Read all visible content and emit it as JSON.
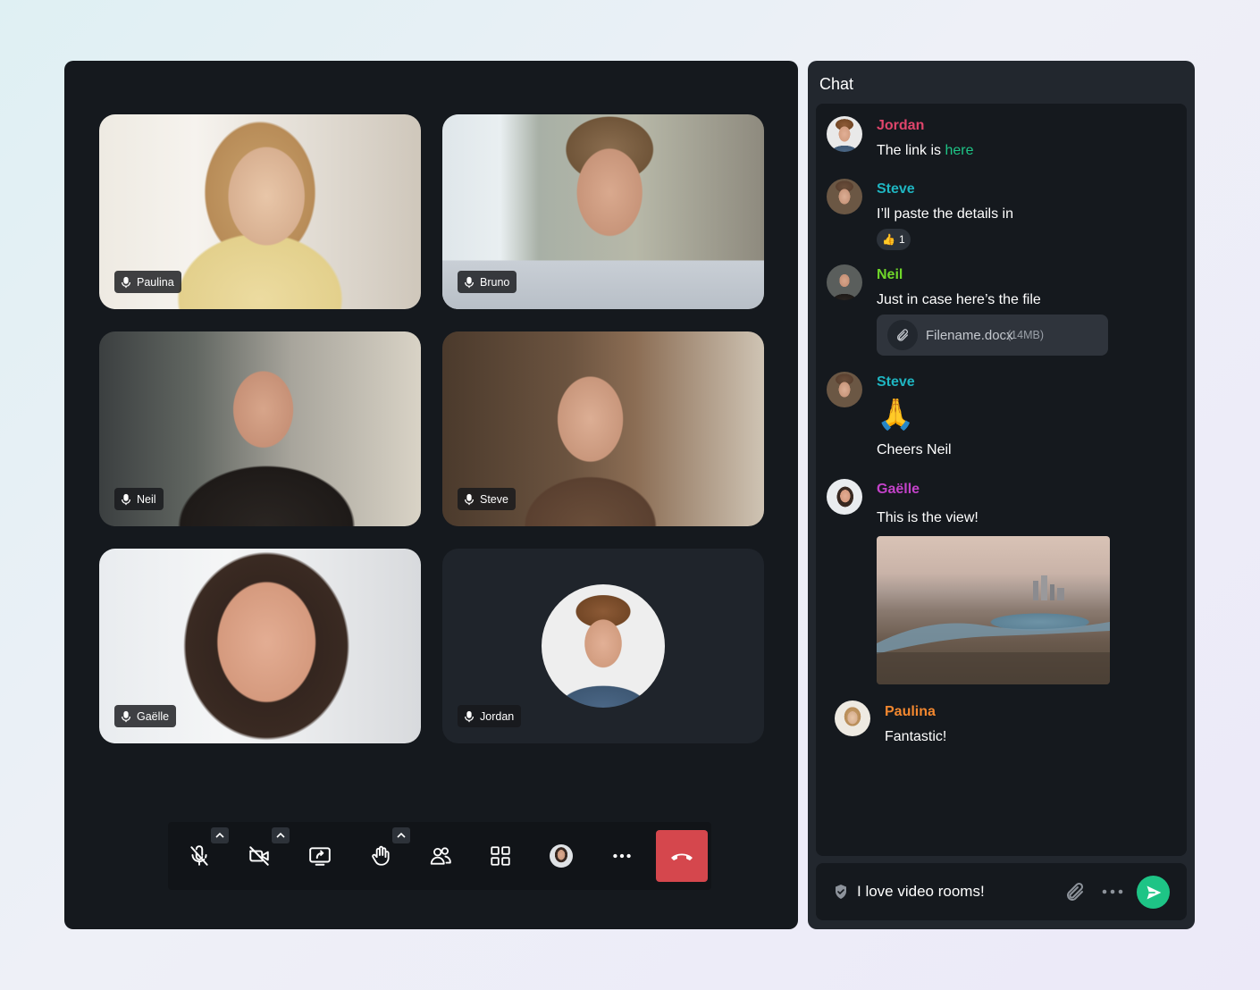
{
  "call": {
    "participants": [
      {
        "name": "Paulina"
      },
      {
        "name": "Bruno"
      },
      {
        "name": "Neil"
      },
      {
        "name": "Steve"
      },
      {
        "name": "Gaëlle"
      },
      {
        "name": "Jordan"
      }
    ],
    "toolbar": {
      "buttons": [
        "mic-off-icon",
        "video-off-icon",
        "share-screen-icon",
        "raise-hand-icon",
        "people-icon",
        "grid-icon",
        "avatar",
        "more-icon",
        "hangup-icon"
      ]
    }
  },
  "chat": {
    "title": "Chat",
    "messages": [
      {
        "sender": "Jordan",
        "color": "#e0456b",
        "text_prefix": "The link is ",
        "link": "here"
      },
      {
        "sender": "Steve",
        "color": "#1fb5c1",
        "text": "I’ll paste the details in",
        "reaction": {
          "emoji": "👍",
          "count": "1"
        }
      },
      {
        "sender": "Neil",
        "color": "#6fd62a",
        "text": "Just in case here’s the file",
        "file": {
          "name": "Filename.docx",
          "size": "(14MB)"
        }
      },
      {
        "sender": "Steve",
        "color": "#1fb5c1",
        "emoji": "🙏",
        "text": "Cheers Neil"
      },
      {
        "sender": "Gaëlle",
        "color": "#c342c9",
        "text": "This is the view!"
      },
      {
        "sender": "Paulina",
        "color": "#f2872f",
        "text": "Fantastic!"
      }
    ],
    "composer": {
      "value": "I love video rooms!"
    }
  }
}
